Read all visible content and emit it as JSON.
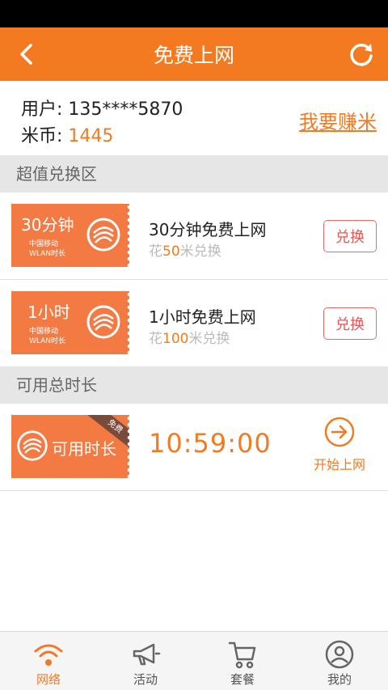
{
  "header": {
    "title": "免费上网"
  },
  "user": {
    "phone_label": "用户: 135****5870",
    "coin_label": "米币: ",
    "coin_value": "1445",
    "earn_link": "我要赚米"
  },
  "sections": {
    "exchange_title": "超值兑换区",
    "total_title": "可用总时长"
  },
  "offers": [
    {
      "coupon_big": "30分钟",
      "coupon_line1": "中国移动",
      "coupon_line2": "WLAN时长",
      "title": "30分钟免费上网",
      "cost_prefix": "花",
      "cost_value": "50",
      "cost_suffix": "米兑换",
      "button": "兑换"
    },
    {
      "coupon_big": "1小时",
      "coupon_line1": "中国移动",
      "coupon_line2": "WLAN时长",
      "title": "1小时免费上网",
      "cost_prefix": "花",
      "cost_value": "100",
      "cost_suffix": "米兑换",
      "button": "兑换"
    }
  ],
  "available": {
    "coupon_label": "可用时长",
    "ribbon": "免费",
    "time": "10:59:00",
    "start_label": "开始上网"
  },
  "nav": [
    {
      "label": "网络",
      "icon": "wifi-icon",
      "active": true
    },
    {
      "label": "活动",
      "icon": "megaphone-icon",
      "active": false
    },
    {
      "label": "套餐",
      "icon": "cart-icon",
      "active": false
    },
    {
      "label": "我的",
      "icon": "user-icon",
      "active": false
    }
  ],
  "colors": {
    "accent": "#f47a22",
    "coupon": "#f47a44"
  }
}
